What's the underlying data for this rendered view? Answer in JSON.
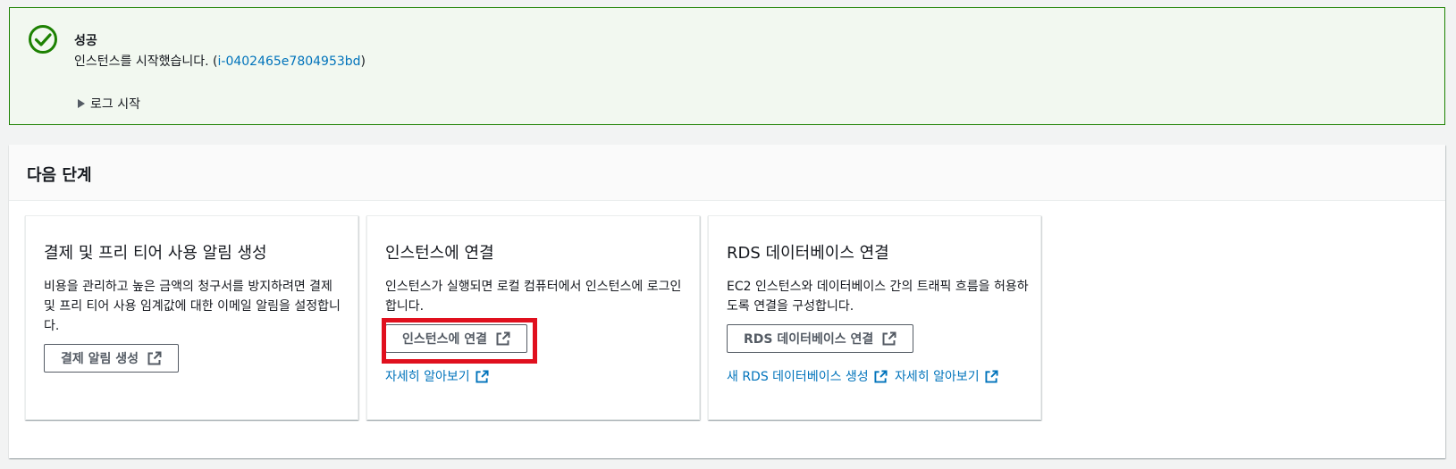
{
  "alert": {
    "title": "성공",
    "message_prefix": "인스턴스를 시작했습니다. (",
    "instance_id": "i-0402465e7804953bd",
    "message_suffix": ")",
    "log_toggle": "로그 시작",
    "color": "#1d8102"
  },
  "next_steps": {
    "title": "다음 단계",
    "cards": [
      {
        "title": "결제 및 프리 티어 사용 알림 생성",
        "description": "비용을 관리하고 높은 금액의 청구서를 방지하려면 결제 및 프리 티어 사용 임계값에 대한 이메일 알림을 설정합니다.",
        "button": "결제 알림 생성"
      },
      {
        "title": "인스턴스에 연결",
        "description": "인스턴스가 실행되면 로컬 컴퓨터에서 인스턴스에 로그인합니다.",
        "button": "인스턴스에 연결",
        "link": "자세히 알아보기"
      },
      {
        "title": "RDS 데이터베이스 연결",
        "description": "EC2 인스턴스와 데이터베이스 간의 트래픽 흐름을 허용하도록 연결을 구성합니다.",
        "button": "RDS 데이터베이스 연결",
        "link1": "새 RDS 데이터베이스 생성",
        "link2": "자세히 알아보기"
      }
    ]
  },
  "colors": {
    "link": "#0073bb",
    "highlight": "#e0101e",
    "button_text": "#545b64"
  }
}
